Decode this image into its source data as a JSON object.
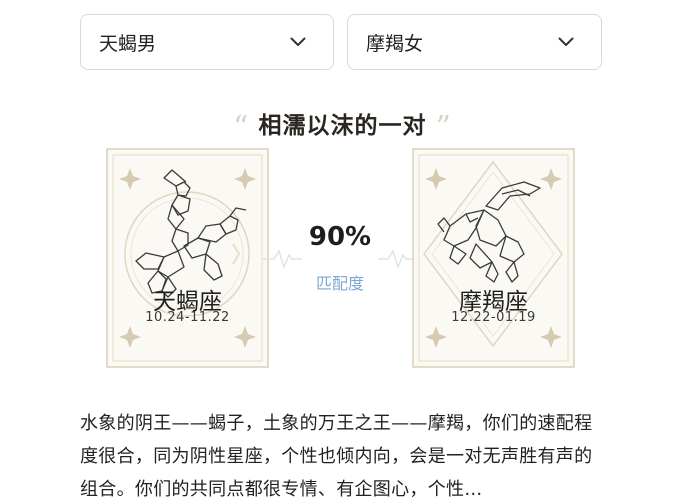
{
  "selectors": {
    "left": {
      "value": "天蝎男"
    },
    "right": {
      "value": "摩羯女"
    }
  },
  "title": {
    "open_quote": "“",
    "text": "相濡以沫的一对",
    "close_quote": "”"
  },
  "cards": {
    "left": {
      "name": "天蝎座",
      "dates": "10.24-11.22",
      "icon": "scorpion-icon"
    },
    "right": {
      "name": "摩羯座",
      "dates": "12.22-01.19",
      "icon": "goat-icon"
    }
  },
  "match": {
    "percent": "90%",
    "label": "匹配度"
  },
  "description": "水象的阴王——蝎子，土象的万王之王——摩羯，你们的速配程度很合，同为阴性星座，个性也倾内向，会是一对无声胜有声的组合。你们的共同点都很专情、有企图心，个性…",
  "colors": {
    "accent": "#7fa7d6",
    "card_border": "#d9cfb8",
    "card_bg": "#fbf9f3"
  }
}
